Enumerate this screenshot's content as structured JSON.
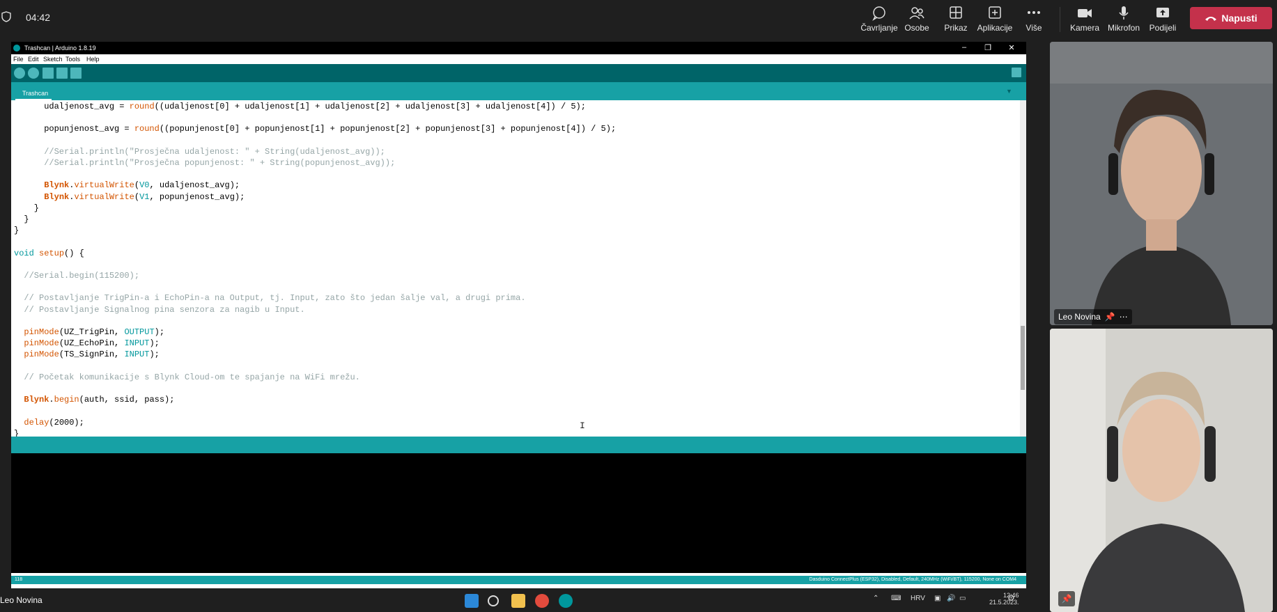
{
  "clock": "04:42",
  "meeting_bar": {
    "buttons": [
      {
        "label": "Čavrljanje",
        "icon": "chat-icon"
      },
      {
        "label": "Osobe",
        "icon": "people-icon"
      },
      {
        "label": "Prikaz",
        "icon": "grid-icon"
      },
      {
        "label": "Aplikacije",
        "icon": "add-app-icon"
      },
      {
        "label": "Više",
        "icon": "more-icon"
      },
      {
        "label": "Kamera",
        "icon": "camera-icon"
      },
      {
        "label": "Mikrofon",
        "icon": "mic-icon"
      },
      {
        "label": "Podijeli",
        "icon": "share-icon"
      }
    ],
    "leave_label": "Napusti",
    "leave_color": "#c4314b"
  },
  "ide": {
    "title": "Trashcan | Arduino 1.8.19",
    "menu": [
      "File",
      "Edit",
      "Sketch",
      "Tools",
      "Help"
    ],
    "tab": "Trashcan",
    "code_lines": [
      "      udaljenost_avg = round((udaljenost[0] + udaljenost[1] + udaljenost[2] + udaljenost[3] + udaljenost[4]) / 5);",
      "",
      "      popunjenost_avg = round((popunjenost[0] + popunjenost[1] + popunjenost[2] + popunjenost[3] + popunjenost[4]) / 5);",
      "",
      "      //Serial.println(\"Prosječna udaljenost: \" + String(udaljenost_avg));",
      "      //Serial.println(\"Prosječna popunjenost: \" + String(popunjenost_avg));",
      "",
      "      Blynk.virtualWrite(V0, udaljenost_avg);",
      "      Blynk.virtualWrite(V1, popunjenost_avg);",
      "    }",
      "  }",
      "}",
      "",
      "void setup() {",
      "",
      "  //Serial.begin(115200);",
      "",
      "  // Postavljanje TrigPin-a i EchoPin-a na Output, tj. Input, zato što jedan šalje val, a drugi prima.",
      "  // Postavljanje Signalnog pina senzora za nagib u Input.",
      "",
      "  pinMode(UZ_TrigPin, OUTPUT);",
      "  pinMode(UZ_EchoPin, INPUT);",
      "  pinMode(TS_SignPin, INPUT);",
      "",
      "  // Početak komunikacije s Blynk Cloud-om te spajanje na WiFi mrežu.",
      "",
      "  Blynk.begin(auth, ssid, pass);",
      "",
      "  delay(2000);",
      "}"
    ],
    "line_number": "118",
    "board_info": "Dasduino ConnectPlus (ESP32), Disabled, Default, 240MHz (WiFi/BT), 115200, None on COM4",
    "accent": "#00979c"
  },
  "participants": [
    {
      "name": "Leo Novina",
      "pinned": true
    }
  ],
  "taskbar": {
    "user_name": "Leo Novina",
    "lang": "HRV",
    "time": "12:46",
    "date": "21.5.2023."
  }
}
